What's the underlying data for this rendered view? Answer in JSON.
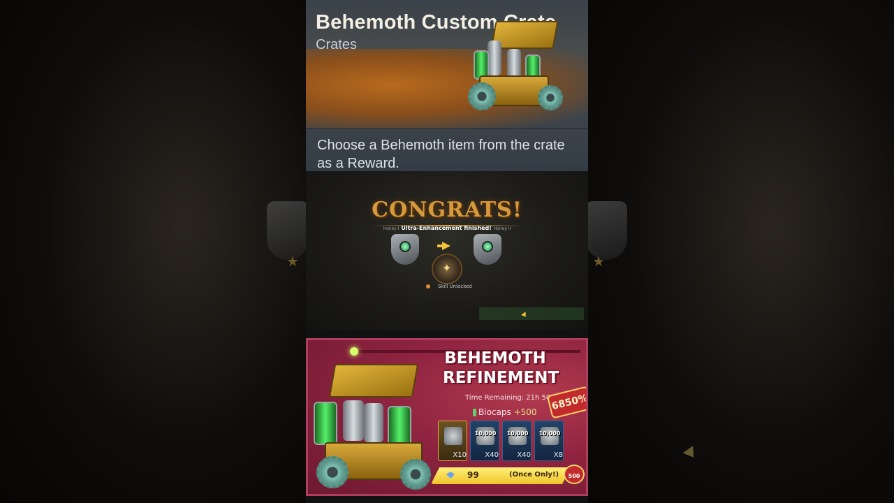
{
  "crate_card": {
    "title": "Behemoth Custom Crate",
    "type": "Crates",
    "description": "Choose a Behemoth item from the crate as a Reward."
  },
  "congrats_panel": {
    "title": "CONGRATS!",
    "left_label": "Honey I",
    "message": "Ultra-Enhancement finished!",
    "right_label": "Honey II",
    "skill_text": "Skill Unlocked"
  },
  "refinement_ad": {
    "title_line1": "BEHEMOTH",
    "title_line2": "REFINEMENT",
    "time_remaining": "Time Remaining: 21h 50m",
    "biocaps_label": "Biocaps",
    "biocaps_bonus": "+500",
    "discount": "6850%",
    "items": [
      {
        "label": "",
        "quantity": "X10"
      },
      {
        "label": "10,000",
        "quantity": "X40"
      },
      {
        "label": "10,000",
        "quantity": "X40"
      },
      {
        "label": "10,000",
        "quantity": "X8"
      }
    ],
    "price": "99",
    "limit": "(Once Only!)",
    "vip_points": "500"
  },
  "colors": {
    "accent_gold": "#f0c42a",
    "ad_crimson": "#8f2440",
    "congrats_orange": "#d59a3c"
  }
}
